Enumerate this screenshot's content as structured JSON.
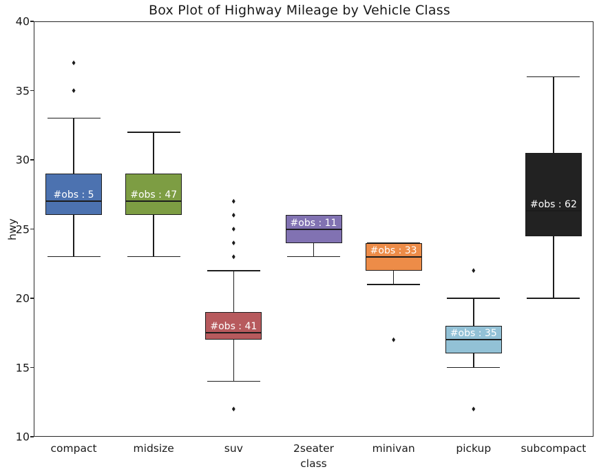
{
  "chart_data": {
    "type": "box",
    "title": "Box Plot of Highway Mileage by Vehicle Class",
    "xlabel": "class",
    "ylabel": "hwy",
    "ylim": [
      10,
      40
    ],
    "yticks": [
      10,
      15,
      20,
      25,
      30,
      35,
      40
    ],
    "ytick_labels": [
      "10",
      "15",
      "20",
      "25",
      "30",
      "35",
      "40"
    ],
    "grid": false,
    "legend": "none",
    "categories": [
      "compact",
      "midsize",
      "suv",
      "2seater",
      "minivan",
      "pickup",
      "subcompact"
    ],
    "boxes": [
      {
        "category": "compact",
        "color": "#4C72B0",
        "whisker_low": 23,
        "q1": 26,
        "median": 27,
        "q3": 29,
        "whisker_high": 33,
        "outliers": [
          35,
          37
        ],
        "n_obs": 5,
        "annotation": "#obs : 5"
      },
      {
        "category": "midsize",
        "color": "#7D9D43",
        "whisker_low": 23,
        "q1": 26,
        "median": 27,
        "q3": 29,
        "whisker_high": 32,
        "outliers": [],
        "n_obs": 47,
        "annotation": "#obs : 47"
      },
      {
        "category": "suv",
        "color": "#B75A5D",
        "whisker_low": 14,
        "q1": 17,
        "median": 17.5,
        "q3": 19,
        "whisker_high": 22,
        "outliers": [
          12,
          23,
          24,
          25,
          26,
          27
        ],
        "n_obs": 41,
        "annotation": "#obs : 41"
      },
      {
        "category": "2seater",
        "color": "#8172B2",
        "whisker_low": 23,
        "q1": 24,
        "median": 25,
        "q3": 26,
        "whisker_high": 26,
        "outliers": [],
        "n_obs": 11,
        "annotation": "#obs : 11"
      },
      {
        "category": "minivan",
        "color": "#ED8C48",
        "whisker_low": 21,
        "q1": 22,
        "median": 23,
        "q3": 24,
        "whisker_high": 24,
        "outliers": [
          17
        ],
        "n_obs": 33,
        "annotation": "#obs : 33"
      },
      {
        "category": "pickup",
        "color": "#92C1D6",
        "whisker_low": 15,
        "q1": 16,
        "median": 17,
        "q3": 18,
        "whisker_high": 20,
        "outliers": [
          12,
          22
        ],
        "n_obs": 35,
        "annotation": "#obs : 35"
      },
      {
        "category": "subcompact",
        "color": "#222222",
        "whisker_low": 20,
        "q1": 24.5,
        "median": 26.3,
        "q3": 30.5,
        "whisker_high": 36,
        "outliers": [],
        "n_obs": 62,
        "annotation": "#obs : 62"
      }
    ]
  }
}
